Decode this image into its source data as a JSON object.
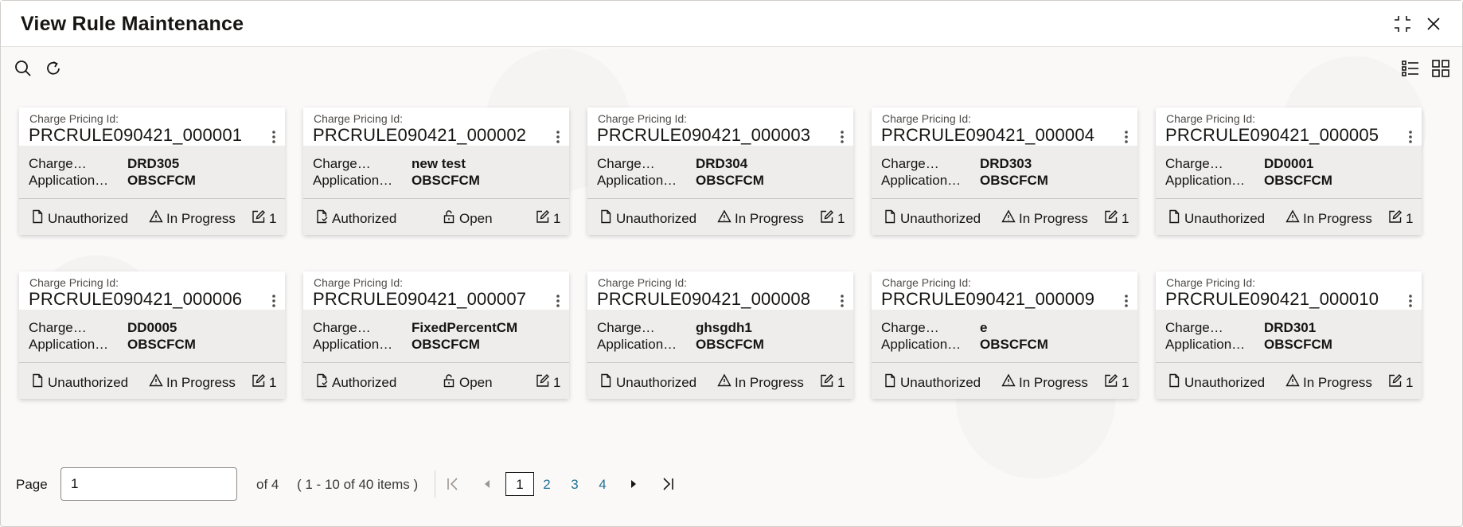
{
  "header": {
    "title": "View Rule Maintenance"
  },
  "cards": [
    {
      "id_label": "Charge Pricing Id",
      "id_value": "PRCRULE090421_000001",
      "field1_label": "Charge…",
      "field1_value": "DRD305",
      "field2_label": "Application…",
      "field2_value": "OBSCFCM",
      "auth_status": "Unauthorized",
      "record_status": "In Progress",
      "mod_count": "1"
    },
    {
      "id_label": "Charge Pricing Id",
      "id_value": "PRCRULE090421_000002",
      "field1_label": "Charge…",
      "field1_value": "new test",
      "field2_label": "Application…",
      "field2_value": "OBSCFCM",
      "auth_status": "Authorized",
      "record_status": "Open",
      "mod_count": "1"
    },
    {
      "id_label": "Charge Pricing Id",
      "id_value": "PRCRULE090421_000003",
      "field1_label": "Charge…",
      "field1_value": "DRD304",
      "field2_label": "Application…",
      "field2_value": "OBSCFCM",
      "auth_status": "Unauthorized",
      "record_status": "In Progress",
      "mod_count": "1"
    },
    {
      "id_label": "Charge Pricing Id",
      "id_value": "PRCRULE090421_000004",
      "field1_label": "Charge…",
      "field1_value": "DRD303",
      "field2_label": "Application…",
      "field2_value": "OBSCFCM",
      "auth_status": "Unauthorized",
      "record_status": "In Progress",
      "mod_count": "1"
    },
    {
      "id_label": "Charge Pricing Id",
      "id_value": "PRCRULE090421_000005",
      "field1_label": "Charge…",
      "field1_value": "DD0001",
      "field2_label": "Application…",
      "field2_value": "OBSCFCM",
      "auth_status": "Unauthorized",
      "record_status": "In Progress",
      "mod_count": "1"
    },
    {
      "id_label": "Charge Pricing Id",
      "id_value": "PRCRULE090421_000006",
      "field1_label": "Charge…",
      "field1_value": "DD0005",
      "field2_label": "Application…",
      "field2_value": "OBSCFCM",
      "auth_status": "Unauthorized",
      "record_status": "In Progress",
      "mod_count": "1"
    },
    {
      "id_label": "Charge Pricing Id",
      "id_value": "PRCRULE090421_000007",
      "field1_label": "Charge…",
      "field1_value": "FixedPercentCM",
      "field2_label": "Application…",
      "field2_value": "OBSCFCM",
      "auth_status": "Authorized",
      "record_status": "Open",
      "mod_count": "1"
    },
    {
      "id_label": "Charge Pricing Id",
      "id_value": "PRCRULE090421_000008",
      "field1_label": "Charge…",
      "field1_value": "ghsgdh1",
      "field2_label": "Application…",
      "field2_value": "OBSCFCM",
      "auth_status": "Unauthorized",
      "record_status": "In Progress",
      "mod_count": "1"
    },
    {
      "id_label": "Charge Pricing Id",
      "id_value": "PRCRULE090421_000009",
      "field1_label": "Charge…",
      "field1_value": "e",
      "field2_label": "Application…",
      "field2_value": "OBSCFCM",
      "auth_status": "Unauthorized",
      "record_status": "In Progress",
      "mod_count": "1"
    },
    {
      "id_label": "Charge Pricing Id",
      "id_value": "PRCRULE090421_000010",
      "field1_label": "Charge…",
      "field1_value": "DRD301",
      "field2_label": "Application…",
      "field2_value": "OBSCFCM",
      "auth_status": "Unauthorized",
      "record_status": "In Progress",
      "mod_count": "1"
    }
  ],
  "pagination": {
    "label": "Page",
    "current_page": "1",
    "of_text": "of 4",
    "range_text": "( 1 - 10 of 40 items )",
    "pages": [
      "1",
      "2",
      "3",
      "4"
    ]
  },
  "colors": {
    "accent_link": "#227097",
    "card_body": "#eeedeb",
    "text": "#161513"
  }
}
